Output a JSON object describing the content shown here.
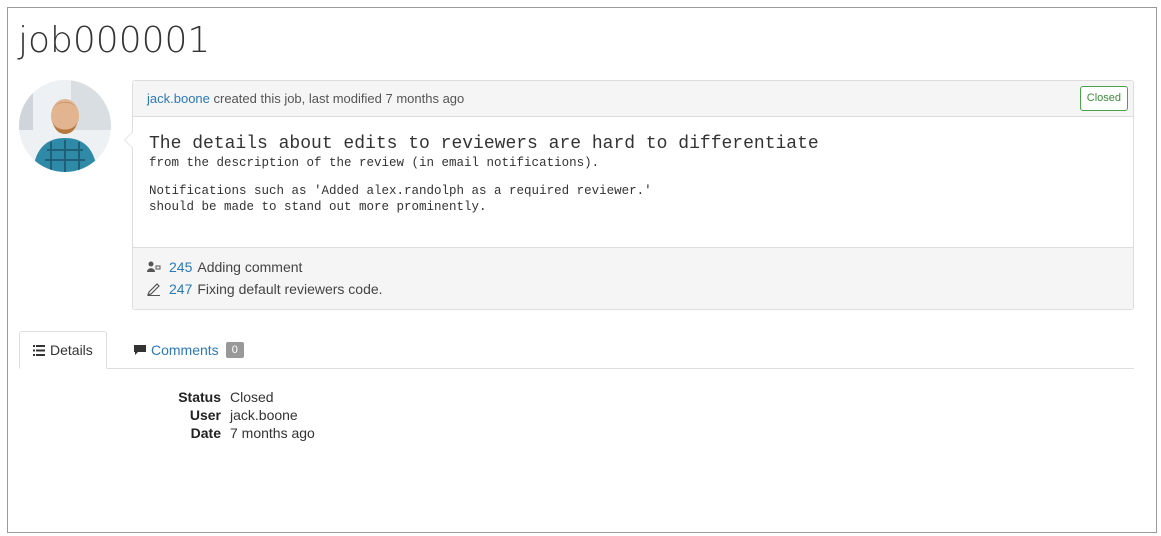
{
  "page": {
    "title": "job000001"
  },
  "job": {
    "author": "jack.boone",
    "header_suffix": " created this job, last modified 7 months ago",
    "status_badge": "Closed",
    "description": {
      "title": "The details about edits to reviewers are hard to differentiate",
      "line1": "from the description of the review (in email notifications).",
      "line2": "Notifications such as 'Added alex.randolph as a required reviewer.'",
      "line3": "should be made to stand out more prominently."
    },
    "linked": [
      {
        "icon": "review-icon",
        "id": "245",
        "text": "Adding comment"
      },
      {
        "icon": "commit-icon",
        "id": "247",
        "text": "Fixing default reviewers code."
      }
    ]
  },
  "tabs": [
    {
      "icon": "list-icon",
      "label": "Details"
    },
    {
      "icon": "comment-icon",
      "label": "Comments",
      "count": "0"
    }
  ],
  "details": {
    "status_label": "Status",
    "status_value": "Closed",
    "user_label": "User",
    "user_value": "jack.boone",
    "date_label": "Date",
    "date_value": "7 months ago"
  },
  "colors": {
    "link": "#2b79b8",
    "closed_badge": "#3b8d3b",
    "panel_bg": "#f5f5f5"
  }
}
